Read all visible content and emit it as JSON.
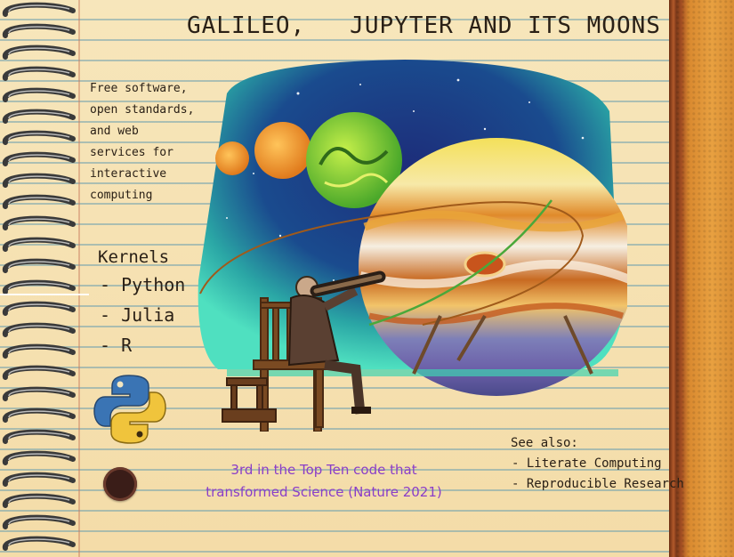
{
  "title": "GALILEO,   JUPYTER AND ITS MOONS",
  "tagline": "Free software, open standards, and web services for interactive computing",
  "kernels": {
    "label": "Kernels",
    "items": [
      "- Python",
      "- Julia",
      "- R"
    ]
  },
  "ranking": "3rd in the Top Ten code that transformed Science (Nature 2021)",
  "see_also": {
    "label": "See also:",
    "items": [
      "- Literate Computing",
      "- Reproducible Research"
    ]
  },
  "icons": [
    "python-logo-icon",
    "spiral-binding-icon",
    "binder-hole-icon"
  ],
  "colors": {
    "paper": "#f4dca8",
    "ruled_line": "#6ea0af",
    "ranking_text": "#8a3ec8",
    "cover": "#d9892f",
    "spiral": "#4a4a4a"
  }
}
